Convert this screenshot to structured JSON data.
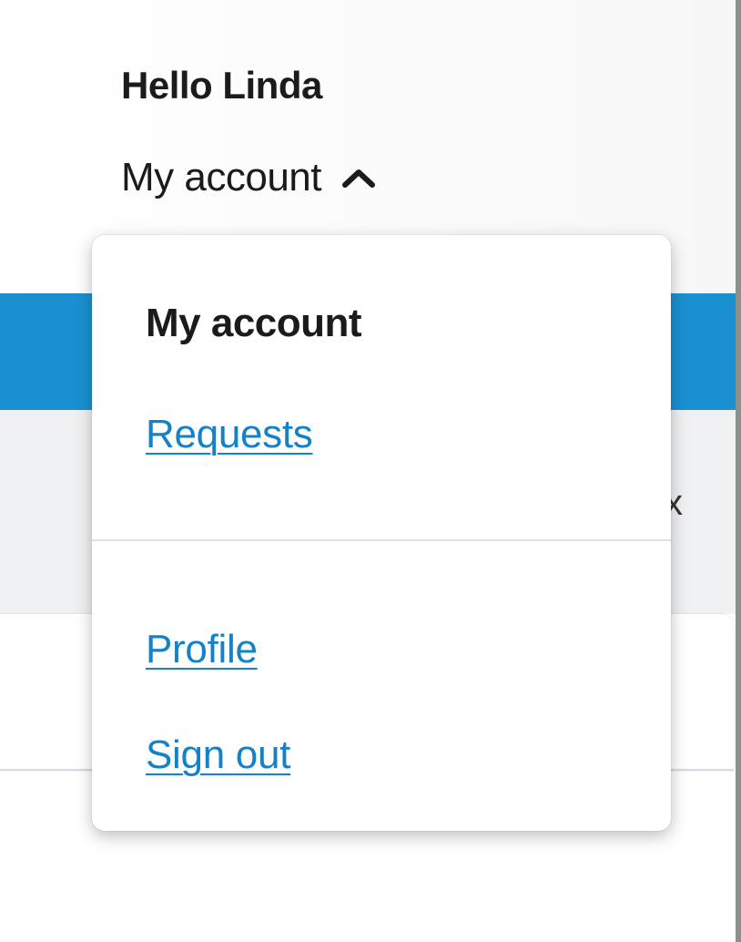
{
  "header": {
    "greeting": "Hello Linda",
    "account_toggle_label": "My account",
    "toggle_icon": "chevron-up-icon"
  },
  "background": {
    "close_glyph": "x"
  },
  "dropdown": {
    "heading": "My account",
    "items": [
      {
        "label": "Requests"
      },
      {
        "label": "Profile"
      },
      {
        "label": "Sign out"
      }
    ]
  },
  "colors": {
    "link": "#1581c6",
    "banner": "#1a90d0",
    "text": "#1b1b1b",
    "panel_bg": "#eff0f2"
  }
}
